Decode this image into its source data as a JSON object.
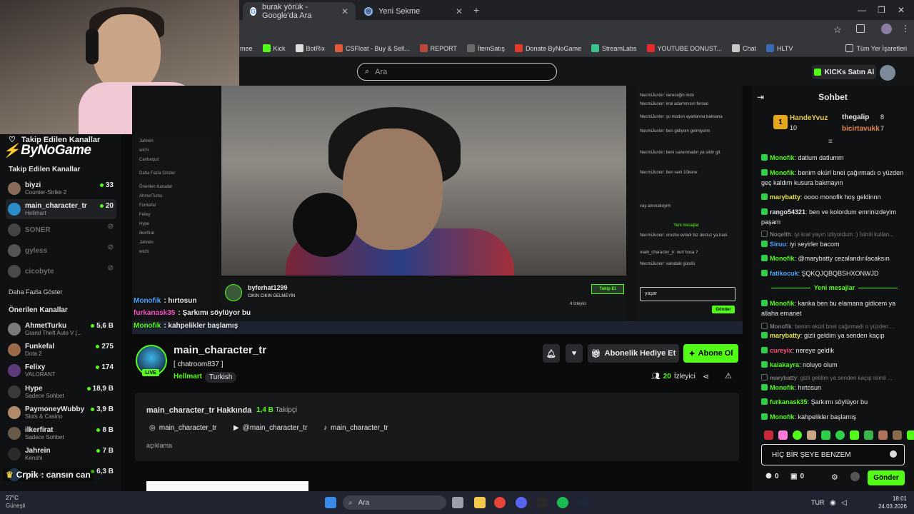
{
  "browser": {
    "tabs": [
      {
        "title": "burak yörük - Google'da Ara"
      },
      {
        "title": "Yeni Sekme"
      }
    ],
    "bookmarks": [
      "mee",
      "Kick",
      "BotRix",
      "CSFloat - Buy & Sell...",
      "REPORT",
      "İtemSatış",
      "Donate ByNoGame",
      "StreamLabs",
      "YOUTUBE DONUST...",
      "Chat",
      "HLTV"
    ],
    "bookmarks_right": "Tüm Yer İşaretleri"
  },
  "header": {
    "search_placeholder": "Ara",
    "kicks_button": "KICKs Satın Al"
  },
  "overlay": {
    "brand": "ByNoGame",
    "followed_heading": "Takip Edilen Kanallar"
  },
  "sidebar": {
    "followed_heading": "Takip Edilen Kanallar",
    "followed": [
      {
        "name": "biyzi",
        "sub": "Counter-Strike 2",
        "count": "33",
        "live": true,
        "color": "#8a6b5a"
      },
      {
        "name": "main_character_tr",
        "sub": "Hellmart",
        "count": "20",
        "live": true,
        "color": "#2a8cc9"
      },
      {
        "name": "SONER",
        "sub": "",
        "count": "",
        "live": false,
        "color": "#444"
      },
      {
        "name": "gyless",
        "sub": "",
        "count": "",
        "live": false,
        "color": "#555"
      },
      {
        "name": "cicobyte",
        "sub": "",
        "count": "",
        "live": false,
        "color": "#4a4a4a"
      }
    ],
    "show_more": "Daha Fazla Göster",
    "recommended_heading": "Önerilen Kanallar",
    "recommended": [
      {
        "name": "AhmetTurku",
        "sub": "Grand Theft Auto V (...",
        "count": "5,6 B",
        "color": "#7a7a7a"
      },
      {
        "name": "Funkefal",
        "sub": "Dota 2",
        "count": "275",
        "color": "#9a6a4a"
      },
      {
        "name": "Felixy",
        "sub": "VALORANT",
        "count": "174",
        "color": "#5a3a7a"
      },
      {
        "name": "Hype",
        "sub": "Sadece Sohbet",
        "count": "18,9 B",
        "color": "#3a3a3a"
      },
      {
        "name": "PaymoneyWubby",
        "sub": "Slots & Casino",
        "count": "3,9 B",
        "color": "#b08a6a"
      },
      {
        "name": "ilkerfirat",
        "sub": "Sadece Sohbet",
        "count": "8 B",
        "color": "#6a5a4a"
      },
      {
        "name": "Jahrein",
        "sub": "Kenshi",
        "count": "7 B",
        "color": "#2a2a2a"
      },
      {
        "name": "",
        "sub": "League of Legends",
        "count": "6,3 B",
        "color": "#3a5a7a"
      }
    ]
  },
  "video_overlay": {
    "lines": [
      {
        "user": "Monofik",
        "text": ": hırtosun"
      },
      {
        "user": "furkanask35",
        "text": ": Şarkımı söylüyor bu"
      },
      {
        "user": "Monofik",
        "text": ": kahpelikler başlamış"
      },
      {
        "user": "Crpik",
        "text": ": cansın can"
      }
    ],
    "inner_streamer": "byferhat1299",
    "inner_title": "CIKIN CIKIN GELMEYİN",
    "inner_follow": "Takip Et",
    "inner_input": "yaşar",
    "inner_send": "Gönder",
    "inner_new_msgs": "Yeni mesajlar",
    "inner_viewers": "4 İzleyici"
  },
  "channel": {
    "name": "main_character_tr",
    "title": "[ chatroom837 ]",
    "category": "Hellmart",
    "tag": "Turkish",
    "live_badge": "LIVE",
    "gift_button": "Abonelik Hediye Et",
    "subscribe_button": "Abone Ol",
    "viewer_count": "20",
    "viewer_label": "İzleyici",
    "about_title": "main_character_tr Hakkında",
    "followers_count": "1,4 B",
    "followers_label": "Takipçi",
    "socials": {
      "instagram": "main_character_tr",
      "youtube": "@main_character_tr",
      "tiktok": "main_character_tr"
    },
    "description": "açıklama"
  },
  "chat": {
    "title": "Sohbet",
    "top_gifters": [
      {
        "rank": "1",
        "name": "HandeYvuz",
        "count": "10"
      },
      {
        "name": "thegalip",
        "count": "8"
      },
      {
        "name": "bicirtavukk",
        "count": "7"
      }
    ],
    "messages": [
      {
        "user": "Monofik",
        "color": "#53fc18",
        "text": "datlum datlumm",
        "dim": false
      },
      {
        "user": "Monofik",
        "color": "#53fc18",
        "text": "benim ekürl bnei çağırmadı o yüzden geç kaldım kusura bakmayın",
        "dim": false
      },
      {
        "user": "marybatty",
        "color": "#e6e64d",
        "text": "oooo monofik hoş geldinnn",
        "dim": false
      },
      {
        "user": "rango54321",
        "color": "#e4e4e4",
        "text": "ben ve kolordum emrinizdeyim paşam",
        "dim": false
      },
      {
        "user": "Noqelth",
        "color": "#7c7c7c",
        "text": "iyi kral yayın izliyordum :) İsimli kullan...",
        "dim": true
      },
      {
        "user": "Siruu",
        "color": "#4da6ff",
        "text": "iyi seyirler bacom",
        "dim": false
      },
      {
        "user": "Monofik",
        "color": "#53fc18",
        "text": "@marybatty cezalandırılacaksın",
        "dim": false
      },
      {
        "user": "fatikocuk",
        "color": "#4da6ff",
        "text": "ŞQKQJQBQBSHXONWJD",
        "dim": false
      }
    ],
    "new_messages": "Yeni mesajlar",
    "messages_after": [
      {
        "user": "Monofik",
        "color": "#53fc18",
        "text": "kanka ben bu elamana gidicem ya allaha emanet",
        "dim": false
      },
      {
        "user": "Monofik",
        "color": "#7c7c7c",
        "text": "benim ekürl bnei çağırmadı o yüzden ...",
        "dim": true
      },
      {
        "user": "marybatty",
        "color": "#e6e64d",
        "text": "gizli geldim ya senden kaçıp",
        "dim": false
      },
      {
        "user": "cureyix",
        "color": "#ff4d7a",
        "text": "nereye geldik",
        "dim": false
      },
      {
        "user": "kaiakayra",
        "color": "#53fc18",
        "text": "noluyo olum",
        "dim": false
      },
      {
        "user": "marybatty",
        "color": "#7c7c7c",
        "text": "gizli geldim ya senden kaçıp isimli ...",
        "dim": true
      },
      {
        "user": "Monofik",
        "color": "#53fc18",
        "text": "hırtosun",
        "dim": false
      },
      {
        "user": "furkanask35",
        "color": "#53fc18",
        "text": "Şarkımı söylüyor bu",
        "dim": false
      },
      {
        "user": "Monofik",
        "color": "#53fc18",
        "text": "kahpelikler başlamış",
        "dim": false
      }
    ],
    "input_value": "HİÇ BİR ŞEYE BENZEM",
    "counter_a": "0",
    "counter_b": "0",
    "send_button": "Gönder"
  },
  "taskbar": {
    "weather_temp": "27°C",
    "weather_desc": "Güneşli",
    "search_placeholder": "Ara",
    "language": "TUR",
    "time": "18:01",
    "date": "24.03.2026"
  }
}
